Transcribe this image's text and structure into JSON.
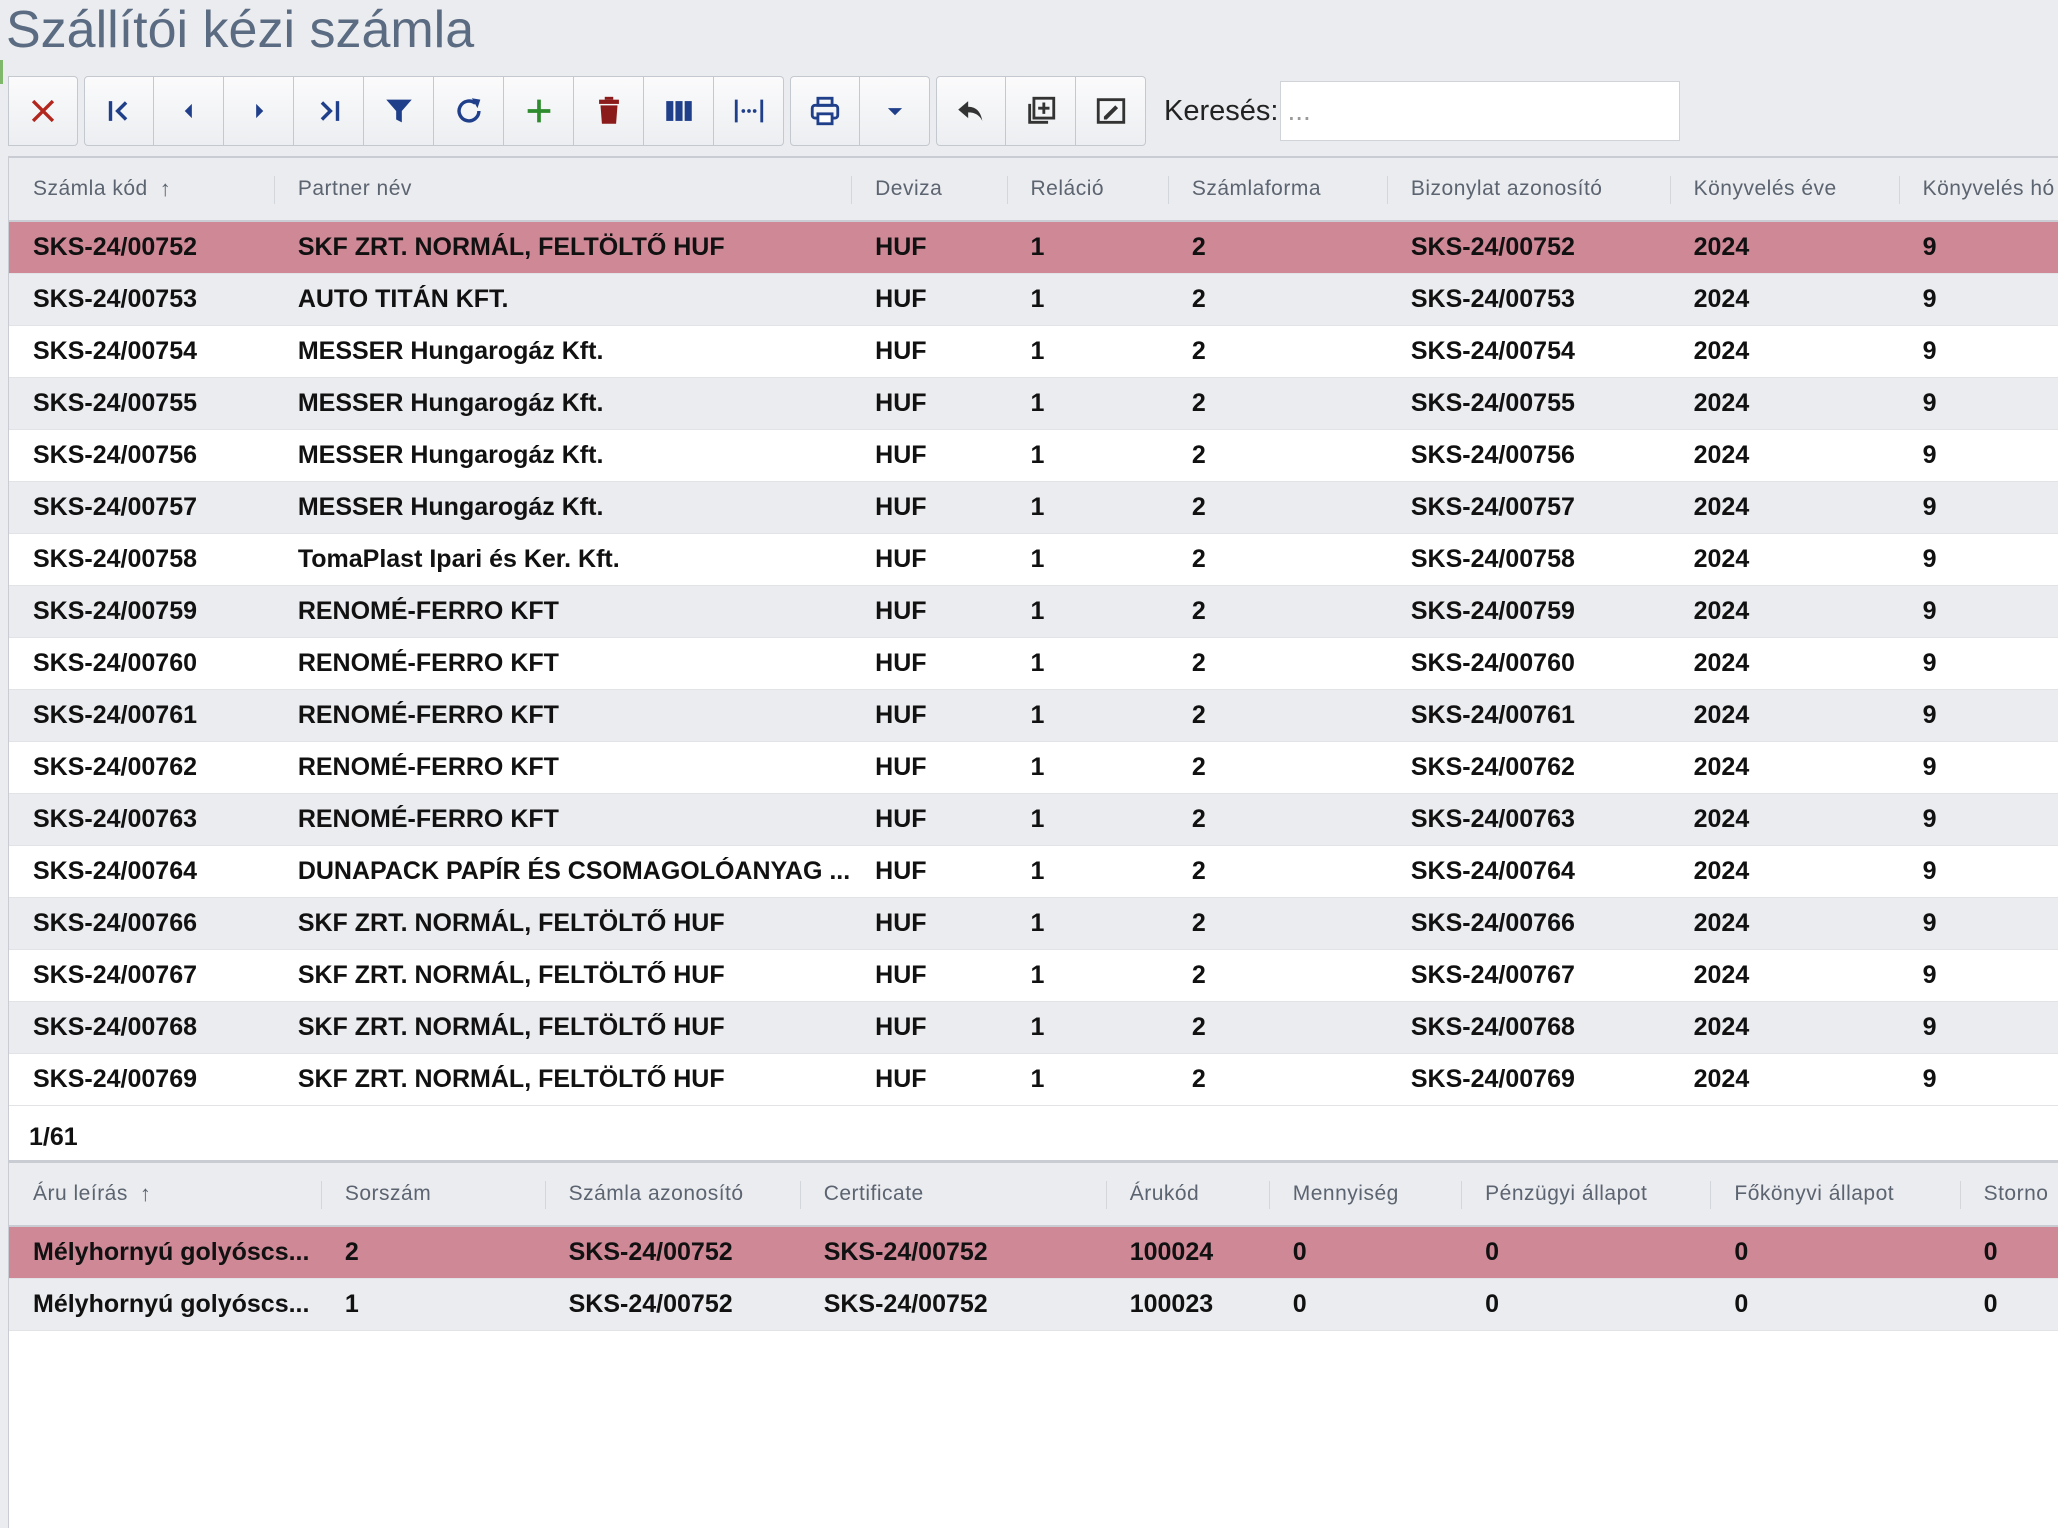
{
  "page_title": "Szállítói kézi számla",
  "toolbar": {
    "buttons": [
      {
        "name": "close-button",
        "icon": "close-icon",
        "color": "#b3261e"
      },
      {
        "name": "first-record-button",
        "icon": "first-page-icon",
        "color": "#1f3f8a"
      },
      {
        "name": "prev-record-button",
        "icon": "caret-left-icon",
        "color": "#1f3f8a"
      },
      {
        "name": "next-record-button",
        "icon": "caret-right-icon",
        "color": "#1f3f8a"
      },
      {
        "name": "last-record-button",
        "icon": "last-page-icon",
        "color": "#1f3f8a"
      },
      {
        "name": "filter-button",
        "icon": "filter-icon",
        "color": "#1f3f8a"
      },
      {
        "name": "refresh-button",
        "icon": "refresh-icon",
        "color": "#1f3f8a"
      },
      {
        "name": "add-button",
        "icon": "plus-icon",
        "color": "#2e8b2e"
      },
      {
        "name": "delete-button",
        "icon": "trash-icon",
        "color": "#8b1a1a"
      },
      {
        "name": "columns-button",
        "icon": "columns-icon",
        "color": "#1f3f8a"
      },
      {
        "name": "fit-width-button",
        "icon": "fit-width-icon",
        "color": "#1f3f8a"
      },
      {
        "name": "print-button",
        "icon": "print-icon",
        "color": "#1f3f8a"
      },
      {
        "name": "print-dropdown-button",
        "icon": "chevron-down-icon",
        "color": "#1f3f8a"
      },
      {
        "name": "undo-button",
        "icon": "reply-icon",
        "color": "#333333"
      },
      {
        "name": "copy-add-button",
        "icon": "copy-plus-icon",
        "color": "#333333"
      },
      {
        "name": "edit-note-button",
        "icon": "signature-icon",
        "color": "#333333"
      }
    ],
    "search_label": "Keresés:",
    "search_placeholder": "..."
  },
  "main_grid": {
    "columns": [
      "Számla kód",
      "Partner név",
      "Deviza",
      "Reláció",
      "Számlaforma",
      "Bizonylat azonosító",
      "Könyvelés éve",
      "Könyvelés hó"
    ],
    "sort_indicator": "↑",
    "rows": [
      [
        "SKS-24/00752",
        "SKF ZRT. NORMÁL, FELTÖLTŐ HUF",
        "HUF",
        "1",
        "2",
        "SKS-24/00752",
        "2024",
        "9"
      ],
      [
        "SKS-24/00753",
        "AUTO TITÁN KFT.",
        "HUF",
        "1",
        "2",
        "SKS-24/00753",
        "2024",
        "9"
      ],
      [
        "SKS-24/00754",
        "MESSER Hungarogáz Kft.",
        "HUF",
        "1",
        "2",
        "SKS-24/00754",
        "2024",
        "9"
      ],
      [
        "SKS-24/00755",
        "MESSER Hungarogáz Kft.",
        "HUF",
        "1",
        "2",
        "SKS-24/00755",
        "2024",
        "9"
      ],
      [
        "SKS-24/00756",
        "MESSER Hungarogáz Kft.",
        "HUF",
        "1",
        "2",
        "SKS-24/00756",
        "2024",
        "9"
      ],
      [
        "SKS-24/00757",
        "MESSER Hungarogáz Kft.",
        "HUF",
        "1",
        "2",
        "SKS-24/00757",
        "2024",
        "9"
      ],
      [
        "SKS-24/00758",
        "TomaPlast Ipari és Ker. Kft.",
        "HUF",
        "1",
        "2",
        "SKS-24/00758",
        "2024",
        "9"
      ],
      [
        "SKS-24/00759",
        "RENOMÉ-FERRO KFT",
        "HUF",
        "1",
        "2",
        "SKS-24/00759",
        "2024",
        "9"
      ],
      [
        "SKS-24/00760",
        "RENOMÉ-FERRO KFT",
        "HUF",
        "1",
        "2",
        "SKS-24/00760",
        "2024",
        "9"
      ],
      [
        "SKS-24/00761",
        "RENOMÉ-FERRO KFT",
        "HUF",
        "1",
        "2",
        "SKS-24/00761",
        "2024",
        "9"
      ],
      [
        "SKS-24/00762",
        "RENOMÉ-FERRO KFT",
        "HUF",
        "1",
        "2",
        "SKS-24/00762",
        "2024",
        "9"
      ],
      [
        "SKS-24/00763",
        "RENOMÉ-FERRO KFT",
        "HUF",
        "1",
        "2",
        "SKS-24/00763",
        "2024",
        "9"
      ],
      [
        "SKS-24/00764",
        "DUNAPACK PAPÍR ÉS CSOMAGOLÓANYAG ...",
        "HUF",
        "1",
        "2",
        "SKS-24/00764",
        "2024",
        "9"
      ],
      [
        "SKS-24/00766",
        "SKF ZRT. NORMÁL, FELTÖLTŐ HUF",
        "HUF",
        "1",
        "2",
        "SKS-24/00766",
        "2024",
        "9"
      ],
      [
        "SKS-24/00767",
        "SKF ZRT. NORMÁL, FELTÖLTŐ HUF",
        "HUF",
        "1",
        "2",
        "SKS-24/00767",
        "2024",
        "9"
      ],
      [
        "SKS-24/00768",
        "SKF ZRT. NORMÁL, FELTÖLTŐ HUF",
        "HUF",
        "1",
        "2",
        "SKS-24/00768",
        "2024",
        "9"
      ],
      [
        "SKS-24/00769",
        "SKF ZRT. NORMÁL, FELTÖLTŐ HUF",
        "HUF",
        "1",
        "2",
        "SKS-24/00769",
        "2024",
        "9"
      ]
    ],
    "selected_row": 0,
    "pager": "1/61"
  },
  "detail_grid": {
    "columns": [
      "Áru leírás",
      "Sorszám",
      "Számla azonosító",
      "Certificate",
      "Árukód",
      "Mennyiség",
      "Pénzügyi állapot",
      "Főkönyvi állapot",
      "Storno"
    ],
    "sort_indicator": "↑",
    "rows": [
      [
        "Mélyhornyú golyóscs...",
        "2",
        "SKS-24/00752",
        "SKS-24/00752",
        "100024",
        "0",
        "0",
        "0",
        "0"
      ],
      [
        "Mélyhornyú golyóscs...",
        "1",
        "SKS-24/00752",
        "SKS-24/00752",
        "100023",
        "0",
        "0",
        "0",
        "0"
      ]
    ],
    "selected_row": 0
  },
  "colors": {
    "selected_row": "#cf8896",
    "title": "#5a6b82",
    "icon_blue": "#1f3f8a"
  }
}
